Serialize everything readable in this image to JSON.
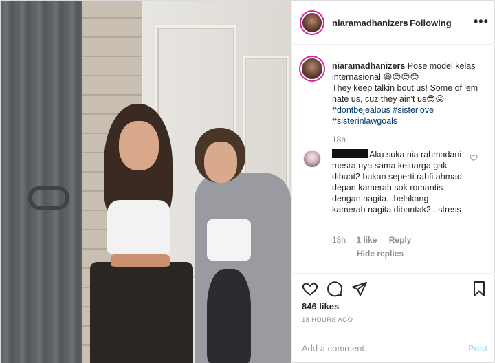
{
  "header": {
    "username": "niaramadhanizers",
    "separator": "•",
    "follow_status": "Following",
    "more": "•••"
  },
  "caption": {
    "username": "niaramadhanizers",
    "line1": "Pose model kelas internasional 😆😍😍😊",
    "line2": "They keep talkin bout us! Some of 'em hate us, cuz they ain't us😎😜",
    "hashtags": [
      "#dontbejealous",
      "#sisterlove",
      "#sisterinlawgoals"
    ],
    "time": "18h"
  },
  "comment": {
    "text": "Aku suka nia rahmadani mesra nya sama keluarga gak dibuat2 bukan seperti rahfi ahmad depan kamerah sok romantis dengan nagita...belakang kamerah nagita dibantak2...stress",
    "time": "18h",
    "likes": "1 like",
    "reply": "Reply",
    "hide_replies": "Hide replies"
  },
  "post_stats": {
    "likes": "846 likes",
    "posted": "18 HOURS AGO"
  },
  "add_comment": {
    "placeholder": "Add a comment...",
    "post_label": "Post"
  },
  "icons": {
    "like": "heart-icon",
    "comment": "comment-icon",
    "share": "share-icon",
    "save": "bookmark-icon",
    "more": "more-icon"
  },
  "colors": {
    "link": "#00376b",
    "muted": "#8e8e8e",
    "post_disabled": "#b2dffc",
    "story_ring": "#d6249f"
  }
}
